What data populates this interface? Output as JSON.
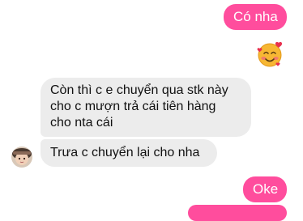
{
  "conversation": {
    "messages": [
      {
        "sender": "me",
        "text": "Có nha"
      },
      {
        "sender": "me",
        "emoji": "smiling-face-with-hearts"
      },
      {
        "sender": "them",
        "lines": [
          "Còn thì c e chuyển qua stk này",
          "cho c mượn trả cái tiên hàng",
          "cho nta cái"
        ]
      },
      {
        "sender": "them",
        "text": "Trưa c chuyển lại cho nha"
      },
      {
        "sender": "me",
        "text": "Oke"
      }
    ]
  },
  "colors": {
    "sent_bubble": "#ff4d9d",
    "received_bubble": "#ececec",
    "background": "#ffffff"
  }
}
